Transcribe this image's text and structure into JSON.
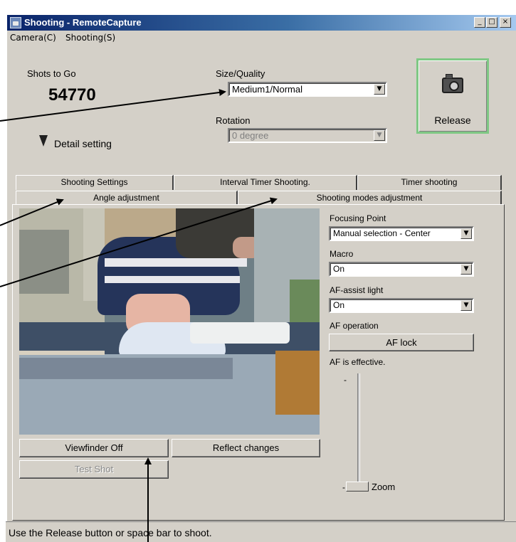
{
  "window": {
    "title": "Shooting - RemoteCapture",
    "controls": [
      "minimize",
      "maximize",
      "close"
    ]
  },
  "menu": [
    "Camera(C)",
    "Shooting(S)"
  ],
  "shots": {
    "label": "Shots to Go",
    "value": "54770"
  },
  "size_quality": {
    "label": "Size/Quality",
    "value": "Medium1/Normal"
  },
  "rotation": {
    "label": "Rotation",
    "value": "0 degree"
  },
  "release": {
    "label": "Release",
    "icon": "camera-icon"
  },
  "detail": {
    "label": "Detail setting",
    "icon": "chevron-down-icon"
  },
  "tabs_row1": [
    "Shooting Settings",
    "Interval Timer Shooting.",
    "Timer shooting"
  ],
  "tabs_row2": [
    "Angle adjustment",
    "Shooting modes adjustment"
  ],
  "focus": {
    "focusing_point_label": "Focusing Point",
    "focusing_point_value": "Manual selection - Center",
    "macro_label": "Macro",
    "macro_value": "On",
    "af_assist_label": "AF-assist light",
    "af_assist_value": "On",
    "af_operation_label": "AF operation",
    "af_lock_label": "AF lock",
    "af_status": "AF is effective."
  },
  "zoom": {
    "label": "Zoom",
    "minus": "-",
    "level": 0
  },
  "buttons": {
    "viewfinder": "Viewfinder Off",
    "reflect": "Reflect changes",
    "test_shot": "Test Shot"
  },
  "status": "Use the Release button or space bar to shoot."
}
